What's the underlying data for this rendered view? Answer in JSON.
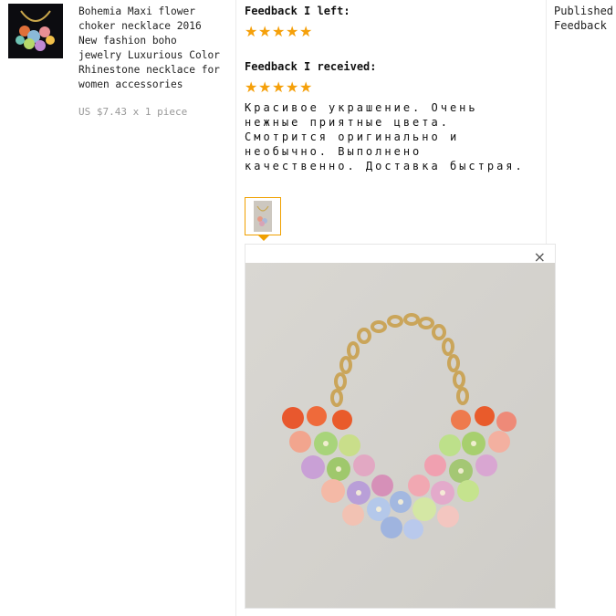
{
  "product": {
    "title": "Bohemia Maxi flower\nchoker necklace 2016\nNew fashion boho\njewelry Luxurious Color\nRhinestone necklace for\nwomen accessories",
    "price": "US $7.43 x 1 piece",
    "thumbnail_icon": "necklace-thumbnail"
  },
  "feedback_left": {
    "heading": "Feedback I left:",
    "rating_stars": 5
  },
  "feedback_received": {
    "heading": "Feedback I received:",
    "rating_stars": 5,
    "text": "Красивое украшение. Очень нежные приятные цвета. Смотрится оригинально и необычно. Выполнено качественно. Доставка быстрая."
  },
  "photo_viewer": {
    "close_label": "×"
  },
  "status": {
    "line1": "Published",
    "line2": "Feedback"
  },
  "colors": {
    "star": "#f5a00a",
    "price": "#999999",
    "thumb_border": "#f0a000"
  }
}
